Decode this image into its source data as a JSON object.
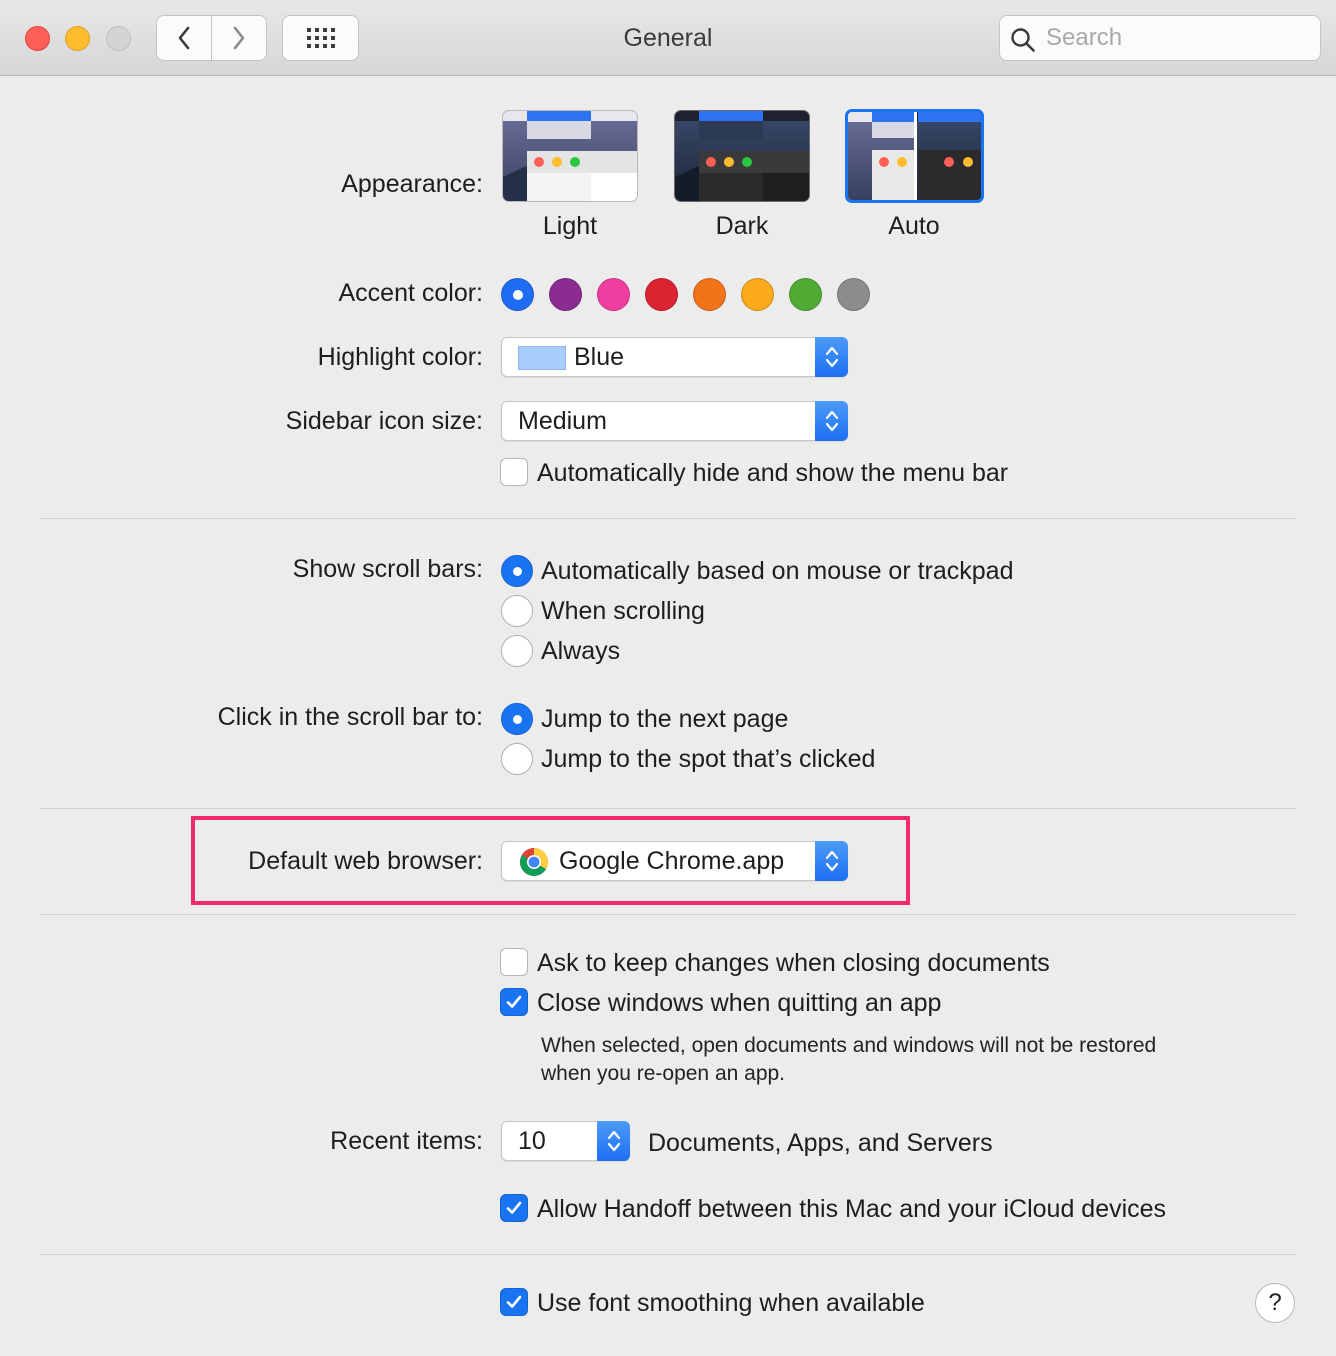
{
  "window": {
    "title": "General",
    "search_placeholder": "Search"
  },
  "appearance": {
    "label": "Appearance:",
    "options": [
      {
        "name": "Light"
      },
      {
        "name": "Dark"
      },
      {
        "name": "Auto",
        "selected": true
      }
    ]
  },
  "accent": {
    "label": "Accent color:",
    "colors": [
      "#1f6cf4",
      "#8b2c91",
      "#ef3ea0",
      "#dc2332",
      "#f27419",
      "#fbaa1b",
      "#4fab34",
      "#8c8c8c"
    ],
    "selected_index": 0
  },
  "highlight": {
    "label": "Highlight color:",
    "value": "Blue",
    "swatch_color": "#a9cdfd"
  },
  "sidebar_icon": {
    "label": "Sidebar icon size:",
    "value": "Medium"
  },
  "menubar": {
    "label": "Automatically hide and show the menu bar",
    "checked": false
  },
  "scroll_bars": {
    "label": "Show scroll bars:",
    "options": [
      {
        "text": "Automatically based on mouse or trackpad",
        "selected": true
      },
      {
        "text": "When scrolling",
        "selected": false
      },
      {
        "text": "Always",
        "selected": false
      }
    ]
  },
  "scroll_click": {
    "label": "Click in the scroll bar to:",
    "options": [
      {
        "text": "Jump to the next page",
        "selected": true
      },
      {
        "text": "Jump to the spot that’s clicked",
        "selected": false
      }
    ]
  },
  "browser": {
    "label": "Default web browser:",
    "value": "Google Chrome.app"
  },
  "documents": {
    "ask_keep": {
      "text": "Ask to keep changes when closing documents",
      "checked": false
    },
    "close_windows": {
      "text": "Close windows when quitting an app",
      "checked": true
    },
    "note_line1": "When selected, open documents and windows will not be restored",
    "note_line2": "when you re-open an app."
  },
  "recent": {
    "label": "Recent items:",
    "value": "10",
    "suffix": "Documents, Apps, and Servers"
  },
  "handoff": {
    "text": "Allow Handoff between this Mac and your iCloud devices",
    "checked": true
  },
  "smoothing": {
    "text": "Use font smoothing when available",
    "checked": true
  },
  "help_symbol": "?"
}
